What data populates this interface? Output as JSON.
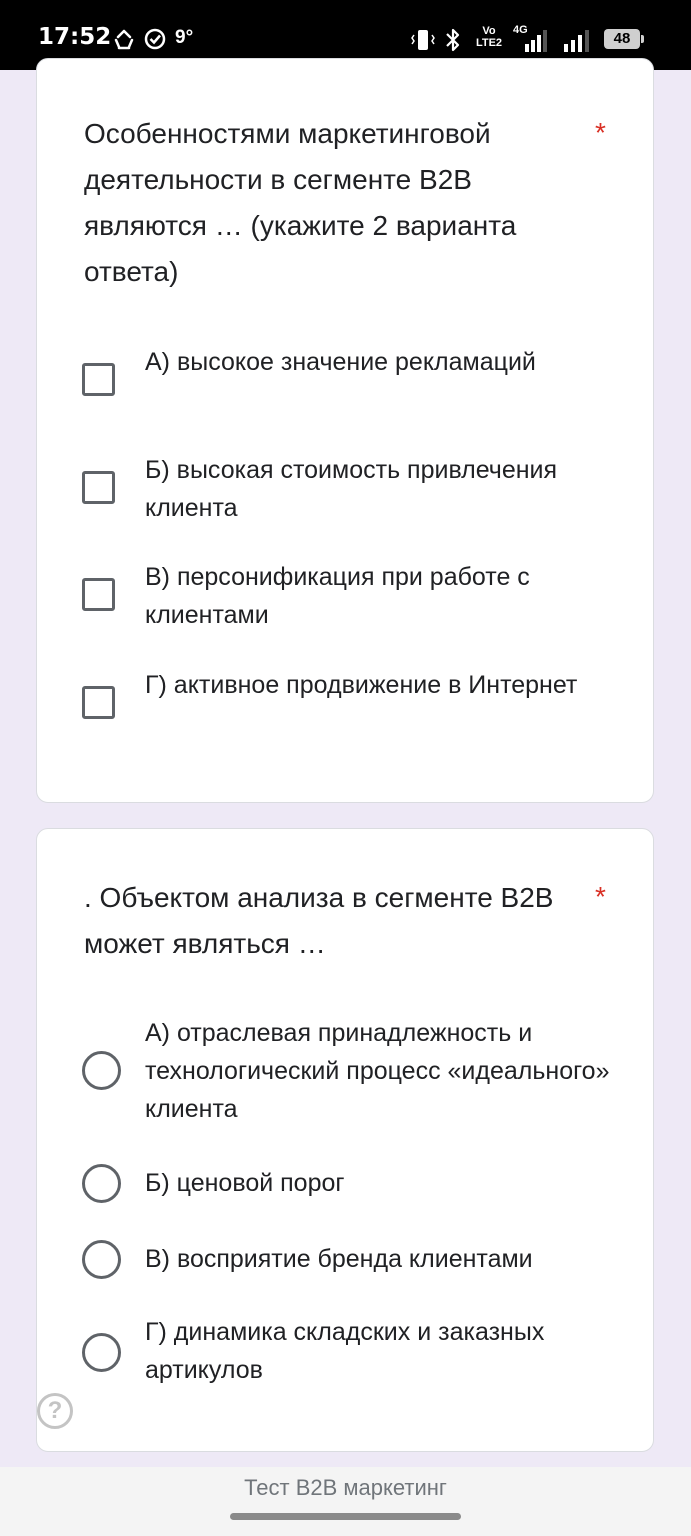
{
  "status_bar": {
    "time": "17:52",
    "temperature": "9°",
    "network_label": "Vo LTE2",
    "network_type": "4G",
    "battery": "48"
  },
  "questions": [
    {
      "title": "Особенностями маркетинговой деятельности в сегменте B2B являются … (укажите 2 варианта ответа)",
      "required_mark": "*",
      "input_type": "checkbox",
      "options": [
        "А) высокое значение рекламаций",
        "Б) высокая стоимость привлечения клиента",
        "В) персонификация при работе с клиентами",
        "Г) активное продвижение в Интернет"
      ]
    },
    {
      "title": ". Объектом анализа в сегменте B2B может являться …",
      "required_mark": "*",
      "input_type": "radio",
      "options": [
        "А) отраслевая принадлежность и технологический процесс «идеального» клиента",
        "Б) ценовой порог",
        "В) восприятие бренда клиентами",
        "Г) динамика складских и заказных артикулов"
      ]
    }
  ],
  "help_icon": "?",
  "footer": {
    "title": "Тест B2B маркетинг"
  },
  "colors": {
    "background": "#eee9f6",
    "required": "#d93025",
    "control_border": "#5f6368"
  }
}
